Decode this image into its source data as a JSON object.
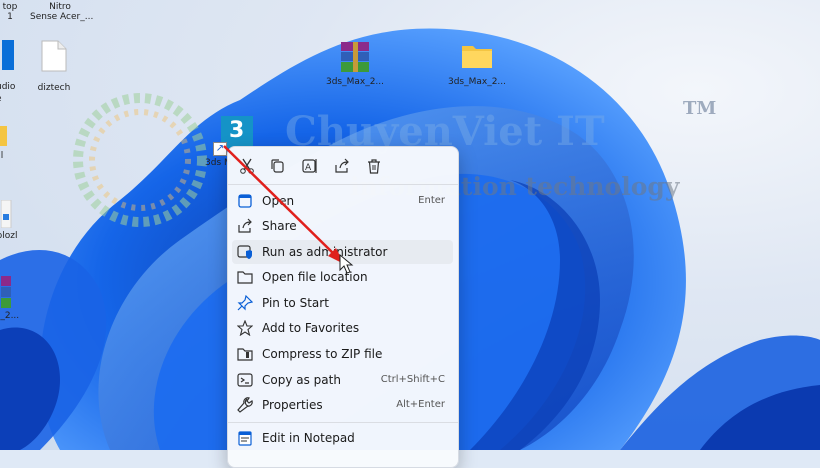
{
  "desktop": {
    "icons": [
      {
        "label_lines": [
          "top",
          "1"
        ]
      },
      {
        "label_lines": [
          "Nitro",
          "Sense Acer_..."
        ]
      },
      {
        "label_lines": [
          "udio",
          "e"
        ]
      },
      {
        "label_lines": [
          "diztech"
        ]
      },
      {
        "label_lines": [
          "3ds_Max_2..."
        ]
      },
      {
        "label_lines": [
          "3ds_Max_2..."
        ]
      },
      {
        "label_lines": [
          "l"
        ]
      },
      {
        "label_lines": [
          "plozl"
        ]
      },
      {
        "label_lines": [
          "a_2..."
        ]
      },
      {
        "label_lines": [
          "3ds M"
        ]
      }
    ],
    "shortcut_badge": "3"
  },
  "watermark": {
    "brand": "ChuyenViet IT",
    "tm": "TM",
    "tagline": "information technology"
  },
  "context_menu": {
    "quick_actions": [
      "cut-icon",
      "copy-icon",
      "rename-icon",
      "share-icon",
      "delete-icon"
    ],
    "items": [
      {
        "label": "Open",
        "shortcut": "Enter",
        "icon": "open-icon"
      },
      {
        "label": "Share",
        "shortcut": "",
        "icon": "share-icon"
      },
      {
        "label": "Run as administrator",
        "shortcut": "",
        "icon": "shield-icon",
        "highlighted": true
      },
      {
        "label": "Open file location",
        "shortcut": "",
        "icon": "folder-icon"
      },
      {
        "label": "Pin to Start",
        "shortcut": "",
        "icon": "pin-icon"
      },
      {
        "label": "Add to Favorites",
        "shortcut": "",
        "icon": "star-icon"
      },
      {
        "label": "Compress to ZIP file",
        "shortcut": "",
        "icon": "zip-icon"
      },
      {
        "label": "Copy as path",
        "shortcut": "Ctrl+Shift+C",
        "icon": "path-icon"
      },
      {
        "label": "Properties",
        "shortcut": "Alt+Enter",
        "icon": "wrench-icon"
      },
      {
        "label": "Edit in Notepad",
        "shortcut": "",
        "icon": "notepad-icon"
      }
    ]
  },
  "colors": {
    "accent": "#0a5fd6",
    "arrow": "#e0201c"
  }
}
